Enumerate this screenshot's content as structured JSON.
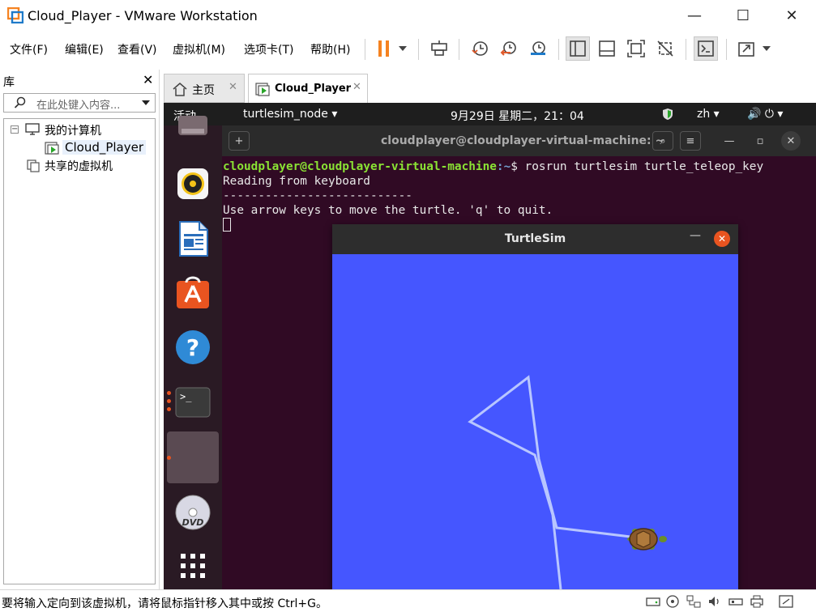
{
  "window": {
    "title": "Cloud_Player - VMware Workstation",
    "minimize_glyph": "—",
    "maximize_glyph": "☐",
    "close_glyph": "✕"
  },
  "menubar": {
    "items": [
      {
        "label": "文件(F)"
      },
      {
        "label": "编辑(E)"
      },
      {
        "label": "查看(V)"
      },
      {
        "label": "虚拟机(M)"
      },
      {
        "label": "选项卡(T)"
      },
      {
        "label": "帮助(H)"
      }
    ]
  },
  "toolbar": {
    "icons": [
      "pause-icon",
      "send-ctrl-alt-del-icon",
      "snapshot-icon",
      "revert-snapshot-icon",
      "snapshot-manager-icon",
      "library-view-icon",
      "thumbnail-view-icon",
      "fullscreen-icon",
      "unity-icon",
      "console-icon",
      "stretch-icon"
    ],
    "pause_color": "#f58220"
  },
  "library": {
    "header": "库",
    "close_glyph": "✕",
    "search_placeholder": "在此处键入内容...",
    "tree": {
      "root": "我的计算机",
      "vm": "Cloud_Player",
      "shared": "共享的虚拟机",
      "expander_glyph": "−"
    }
  },
  "tabs": [
    {
      "label": "主页",
      "close_glyph": "✕",
      "active": false
    },
    {
      "label": "Cloud_Player",
      "close_glyph": "✕",
      "active": true
    }
  ],
  "ubuntu": {
    "topbar": {
      "activities": "活动",
      "app_menu": "turtlesim_node ▾",
      "clock": "9月29日 星期二，21：04",
      "lang": "zh ▾",
      "power": "🔊 ⏻ ▾"
    },
    "dock_apps": [
      "files-icon",
      "rhythmbox-icon",
      "libreoffice-writer-icon",
      "ubuntu-software-icon",
      "help-icon",
      "terminal-icon",
      "running-app-icon",
      "dvd-icon",
      "show-applications-icon"
    ],
    "accent": "#e95420"
  },
  "terminal": {
    "title": "cloudplayer@cloudplayer-virtual-machine: ~",
    "prompt_user": "cloudplayer@cloudplayer-virtual-machine",
    "prompt_path": ":~",
    "prompt_cmd": "$ rosrun turtlesim turtle_teleop_key",
    "line2": "Reading from keyboard",
    "line3": "---------------------------",
    "line4": "Use arrow keys to move the turtle. 'q' to quit.",
    "btn_new_tab": "+",
    "btn_search": "⌕",
    "btn_menu": "≡",
    "btn_min": "—",
    "btn_max": "▫",
    "btn_close": "✕"
  },
  "turtlesim": {
    "title": "TurtleSim",
    "min_glyph": "—",
    "close_glyph": "✕",
    "background": "#4556ff"
  },
  "statusbar": {
    "message": "要将输入定向到该虚拟机，请将鼠标指针移入其中或按 Ctrl+G。",
    "icons": [
      "hard-disk-icon",
      "cd-icon",
      "network-icon",
      "usb-icon",
      "sound-icon",
      "printer-icon",
      "display-icon",
      "fullscreen-status-icon"
    ]
  }
}
